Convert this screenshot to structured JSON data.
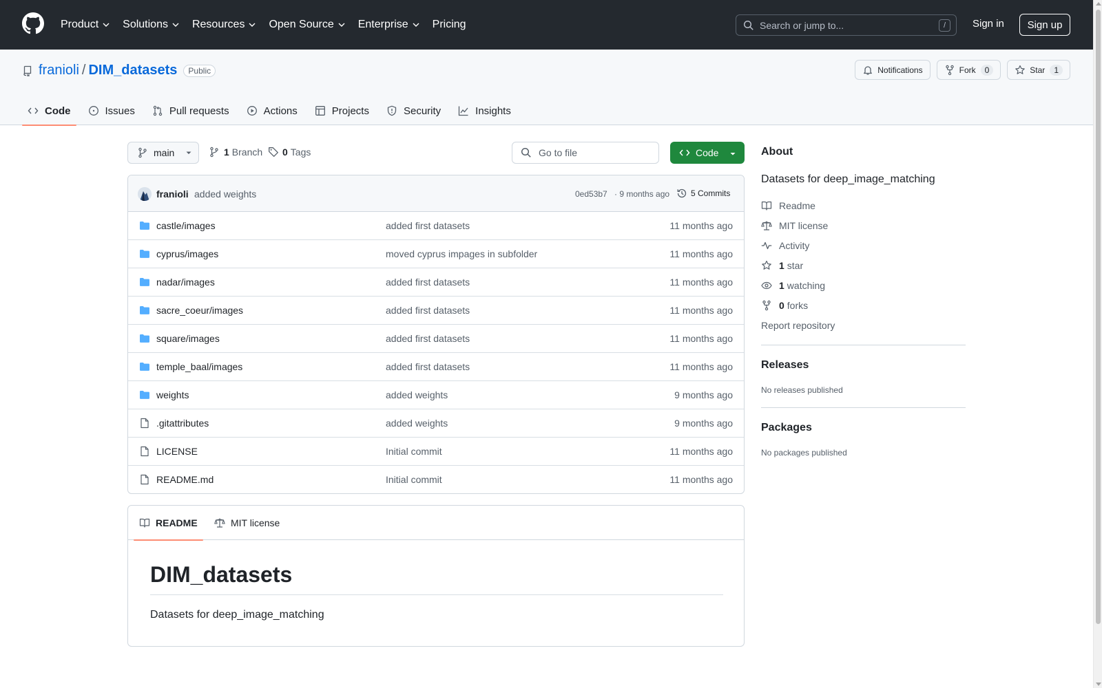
{
  "header": {
    "nav": [
      {
        "label": "Product",
        "has_dropdown": true
      },
      {
        "label": "Solutions",
        "has_dropdown": true
      },
      {
        "label": "Resources",
        "has_dropdown": true
      },
      {
        "label": "Open Source",
        "has_dropdown": true
      },
      {
        "label": "Enterprise",
        "has_dropdown": true
      },
      {
        "label": "Pricing",
        "has_dropdown": false
      }
    ],
    "search_placeholder": "Search or jump to...",
    "search_key": "/",
    "sign_in": "Sign in",
    "sign_up": "Sign up"
  },
  "repo": {
    "owner": "franioli",
    "separator": "/",
    "name": "DIM_datasets",
    "visibility": "Public",
    "notifications_label": "Notifications",
    "fork_label": "Fork",
    "fork_count": "0",
    "star_label": "Star",
    "star_count": "1"
  },
  "tabs": [
    {
      "label": "Code",
      "icon": "code-icon",
      "active": true
    },
    {
      "label": "Issues",
      "icon": "issue-icon",
      "active": false
    },
    {
      "label": "Pull requests",
      "icon": "pull-request-icon",
      "active": false
    },
    {
      "label": "Actions",
      "icon": "play-icon",
      "active": false
    },
    {
      "label": "Projects",
      "icon": "table-icon",
      "active": false
    },
    {
      "label": "Security",
      "icon": "shield-icon",
      "active": false
    },
    {
      "label": "Insights",
      "icon": "graph-icon",
      "active": false
    }
  ],
  "toolbar": {
    "branch": "main",
    "branch_count": "1",
    "branch_label": "Branch",
    "tag_count": "0",
    "tag_label": "Tags",
    "goto_placeholder": "Go to file",
    "code_label": "Code"
  },
  "latest_commit": {
    "author": "franioli",
    "message": "added weights",
    "sha": "0ed53b7",
    "time": "· 9 months ago",
    "commits_label": "5 Commits"
  },
  "files": [
    {
      "name": "castle/images",
      "type": "folder",
      "message": "added first datasets",
      "time": "11 months ago"
    },
    {
      "name": "cyprus/images",
      "type": "folder",
      "message": "moved cyprus impages in subfolder",
      "time": "11 months ago"
    },
    {
      "name": "nadar/images",
      "type": "folder",
      "message": "added first datasets",
      "time": "11 months ago"
    },
    {
      "name": "sacre_coeur/images",
      "type": "folder",
      "message": "added first datasets",
      "time": "11 months ago"
    },
    {
      "name": "square/images",
      "type": "folder",
      "message": "added first datasets",
      "time": "11 months ago"
    },
    {
      "name": "temple_baal/images",
      "type": "folder",
      "message": "added first datasets",
      "time": "11 months ago"
    },
    {
      "name": "weights",
      "type": "folder",
      "message": "added weights",
      "time": "9 months ago"
    },
    {
      "name": ".gitattributes",
      "type": "file",
      "message": "added weights",
      "time": "9 months ago"
    },
    {
      "name": "LICENSE",
      "type": "file",
      "message": "Initial commit",
      "time": "11 months ago"
    },
    {
      "name": "README.md",
      "type": "file",
      "message": "Initial commit",
      "time": "11 months ago"
    }
  ],
  "readme": {
    "tab_readme": "README",
    "tab_license": "MIT license",
    "title": "DIM_datasets",
    "body": "Datasets for deep_image_matching"
  },
  "about": {
    "heading": "About",
    "description": "Datasets for deep_image_matching",
    "readme": "Readme",
    "license": "MIT license",
    "activity": "Activity",
    "stars_count": "1",
    "stars_label": "star",
    "watching_count": "1",
    "watching_label": "watching",
    "forks_count": "0",
    "forks_label": "forks",
    "report": "Report repository"
  },
  "releases": {
    "heading": "Releases",
    "note": "No releases published"
  },
  "packages": {
    "heading": "Packages",
    "note": "No packages published"
  },
  "colors": {
    "header_bg": "#24292f",
    "link": "#0969da",
    "code_button": "#1f883d",
    "folder": "#54aeff",
    "tab_underline": "#fd8c73"
  }
}
